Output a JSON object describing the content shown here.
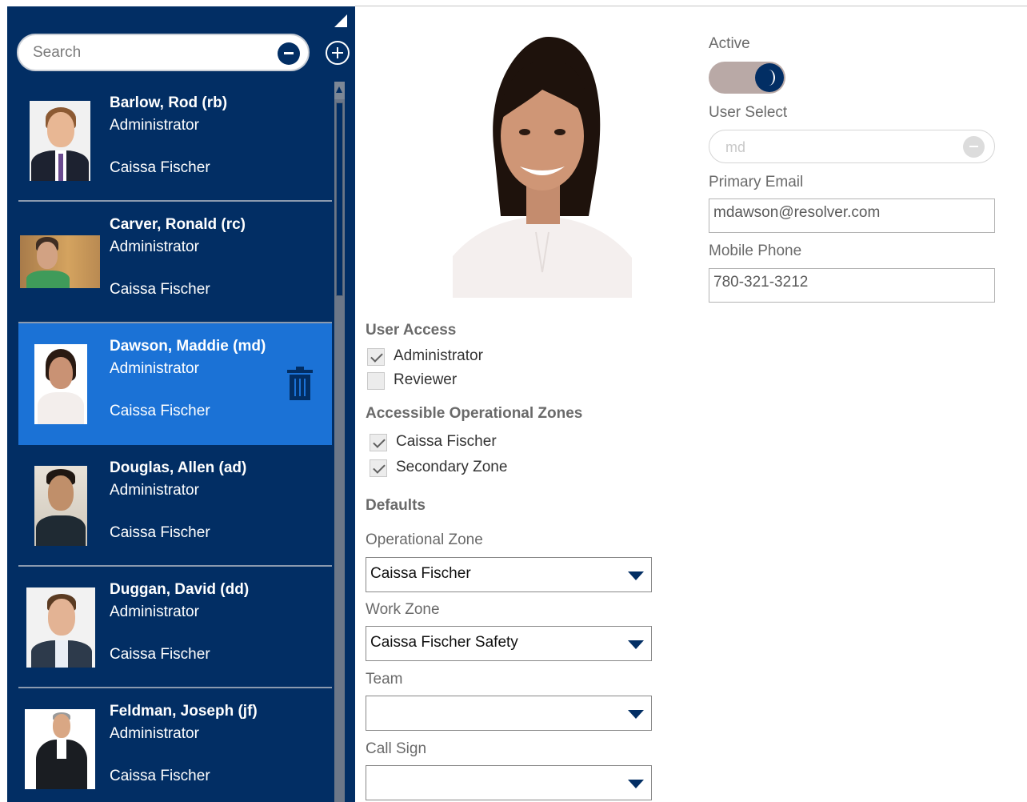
{
  "sidebar": {
    "search_placeholder": "Search",
    "users": [
      {
        "name": "Barlow, Rod (rb)",
        "role": "Administrator",
        "zone": "Caissa Fischer",
        "selected": false
      },
      {
        "name": "Carver, Ronald (rc)",
        "role": "Administrator",
        "zone": "Caissa Fischer",
        "selected": false
      },
      {
        "name": "Dawson, Maddie (md)",
        "role": "Administrator",
        "zone": "Caissa Fischer",
        "selected": true
      },
      {
        "name": "Douglas, Allen (ad)",
        "role": "Administrator",
        "zone": "Caissa Fischer",
        "selected": false
      },
      {
        "name": "Duggan, David (dd)",
        "role": "Administrator",
        "zone": "Caissa Fischer",
        "selected": false
      },
      {
        "name": "Feldman, Joseph (jf)",
        "role": "Administrator",
        "zone": "Caissa Fischer",
        "selected": false
      }
    ]
  },
  "form": {
    "active_label": "Active",
    "active_on": true,
    "user_select_label": "User Select",
    "user_select_value": "md",
    "primary_email_label": "Primary Email",
    "primary_email_value": "mdawson@resolver.com",
    "mobile_phone_label": "Mobile Phone",
    "mobile_phone_value": "780-321-3212",
    "user_access_title": "User Access",
    "user_access": [
      {
        "label": "Administrator",
        "checked": true
      },
      {
        "label": "Reviewer",
        "checked": false
      }
    ],
    "zones_title": "Accessible Operational Zones",
    "zones": [
      {
        "label": "Caissa Fischer",
        "checked": true
      },
      {
        "label": "Secondary Zone",
        "checked": true
      }
    ],
    "defaults_title": "Defaults",
    "operational_zone_label": "Operational Zone",
    "operational_zone_value": "Caissa Fischer",
    "work_zone_label": "Work Zone",
    "work_zone_value": "Caissa Fischer Safety",
    "team_label": "Team",
    "team_value": "",
    "call_sign_label": "Call Sign",
    "call_sign_value": ""
  },
  "colors": {
    "sidebar_bg": "#022e64",
    "selected_bg": "#1b72d6",
    "accent": "#022e64"
  },
  "icons": {
    "search_clear": "minus-circle-icon",
    "add": "plus-circle-icon",
    "delete": "trash-icon",
    "dropdown": "caret-down-icon"
  }
}
